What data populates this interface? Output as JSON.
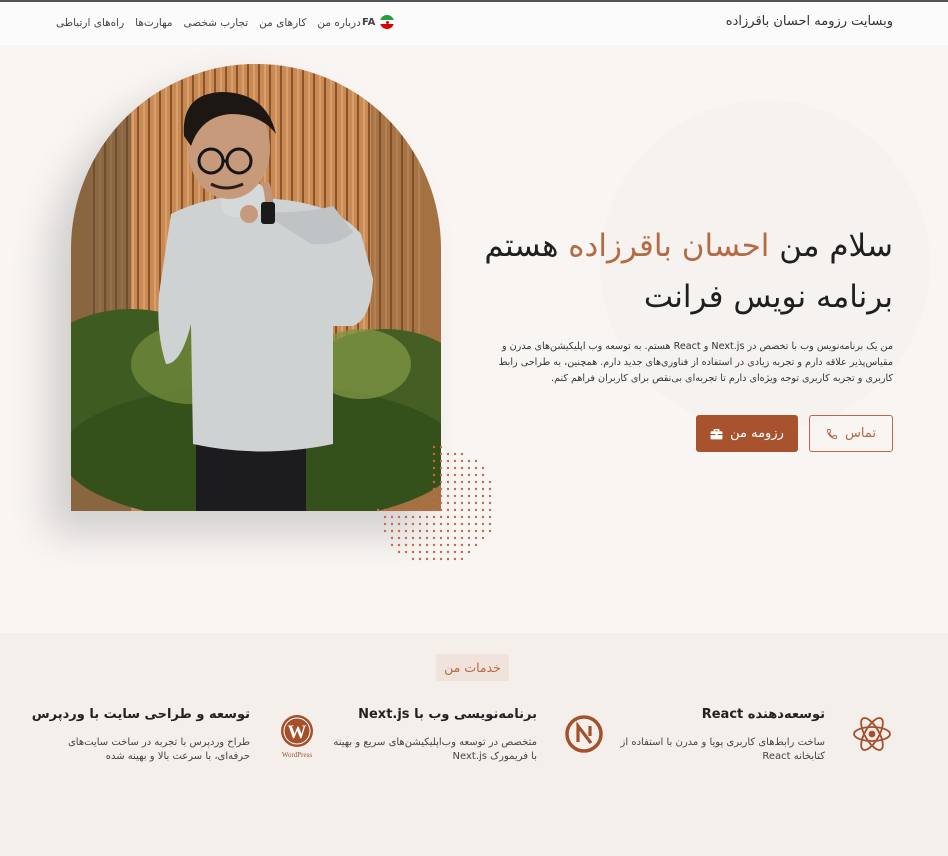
{
  "nav": {
    "brand": "وبسایت رزومه احسان باقرزاده",
    "lang": "FA",
    "menu": [
      "درباره من",
      "کارهای من",
      "تجارب شخصی",
      "مهارت‌ها",
      "راه‌های ارتباطی"
    ]
  },
  "hero": {
    "greeting_before": "سلام من",
    "name": "احسان باقرزاده",
    "greeting_after": "هستم",
    "role": "برنامه نویس فرانت",
    "intro": "من یک برنامه‌نویس وب با تخصص در Next.js و React هستم. به توسعه وب اپلیکیشن‌های مدرن و مقیاس‌پذیر علاقه دارم و تجربه زیادی در استفاده از فناوری‌های جدید دارم. همچنین، به طراحی رابط کاربری و تجربه کاربری توجه ویژه‌ای دارم تا تجربه‌ای بی‌نقص برای کاربران فراهم کنم.",
    "contact_label": "تماس",
    "resume_label": "رزومه من"
  },
  "services": {
    "title": "خدمات من",
    "items": [
      {
        "icon": "react-icon",
        "title": "توسعه‌دهنده React",
        "desc": "ساخت رابط‌های کاربری پویا و مدرن با استفاده از کتابخانه React"
      },
      {
        "icon": "nextjs-icon",
        "title": "برنامه‌نویسی وب با Next.js",
        "desc": "متخصص در توسعه وب‌اپلیکیشن‌های سریع و بهینه با فریمورک Next.js"
      },
      {
        "icon": "wordpress-icon",
        "title": "توسعه و طراحی سایت با وردپرس",
        "desc": "طراح وردپرس با تجربه در ساخت سایت‌های حرفه‌ای، با سرعت بالا و بهینه شده",
        "logo_text": "WordPress"
      }
    ]
  },
  "colors": {
    "accent": "#b56a43",
    "button_fill": "#a9522e",
    "services_bg": "#f5efeb"
  }
}
